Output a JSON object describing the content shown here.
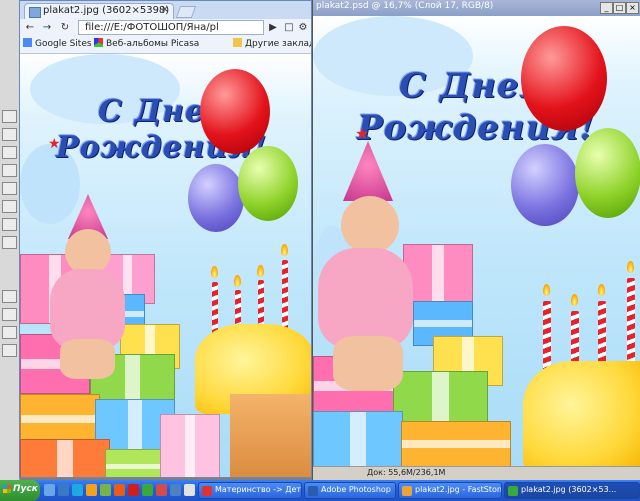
{
  "chrome": {
    "tab_title": "plakat2.jpg (3602×5398)",
    "tab_close": "×",
    "back": "←",
    "forward": "→",
    "reload": "↻",
    "url": "file:///E:/ФОТОШОП/Яна/pl",
    "go": "▶",
    "bookmarks": [
      "Google Sites",
      "Веб-альбомы Picasa",
      "Другие закладки"
    ]
  },
  "poster": {
    "line1": "С Днем",
    "line2": "Рождения!"
  },
  "psdoc": {
    "title": "plakat2.psd @ 16,7% (Слой 17, RGB/8)",
    "minimize": "_",
    "maximize": "□",
    "close": "×",
    "status": "Док: 55,6M/236,1M"
  },
  "taskbar": {
    "start_label": "Пуск",
    "tasks": [
      "Материнство -> Детск...",
      "Adobe Photoshop",
      "plakat2.jpg - FastStone",
      "plakat2.jpg (3602×53..."
    ]
  },
  "colors": {
    "accent": "#2b4fb0",
    "taskbar": "#245edb"
  }
}
